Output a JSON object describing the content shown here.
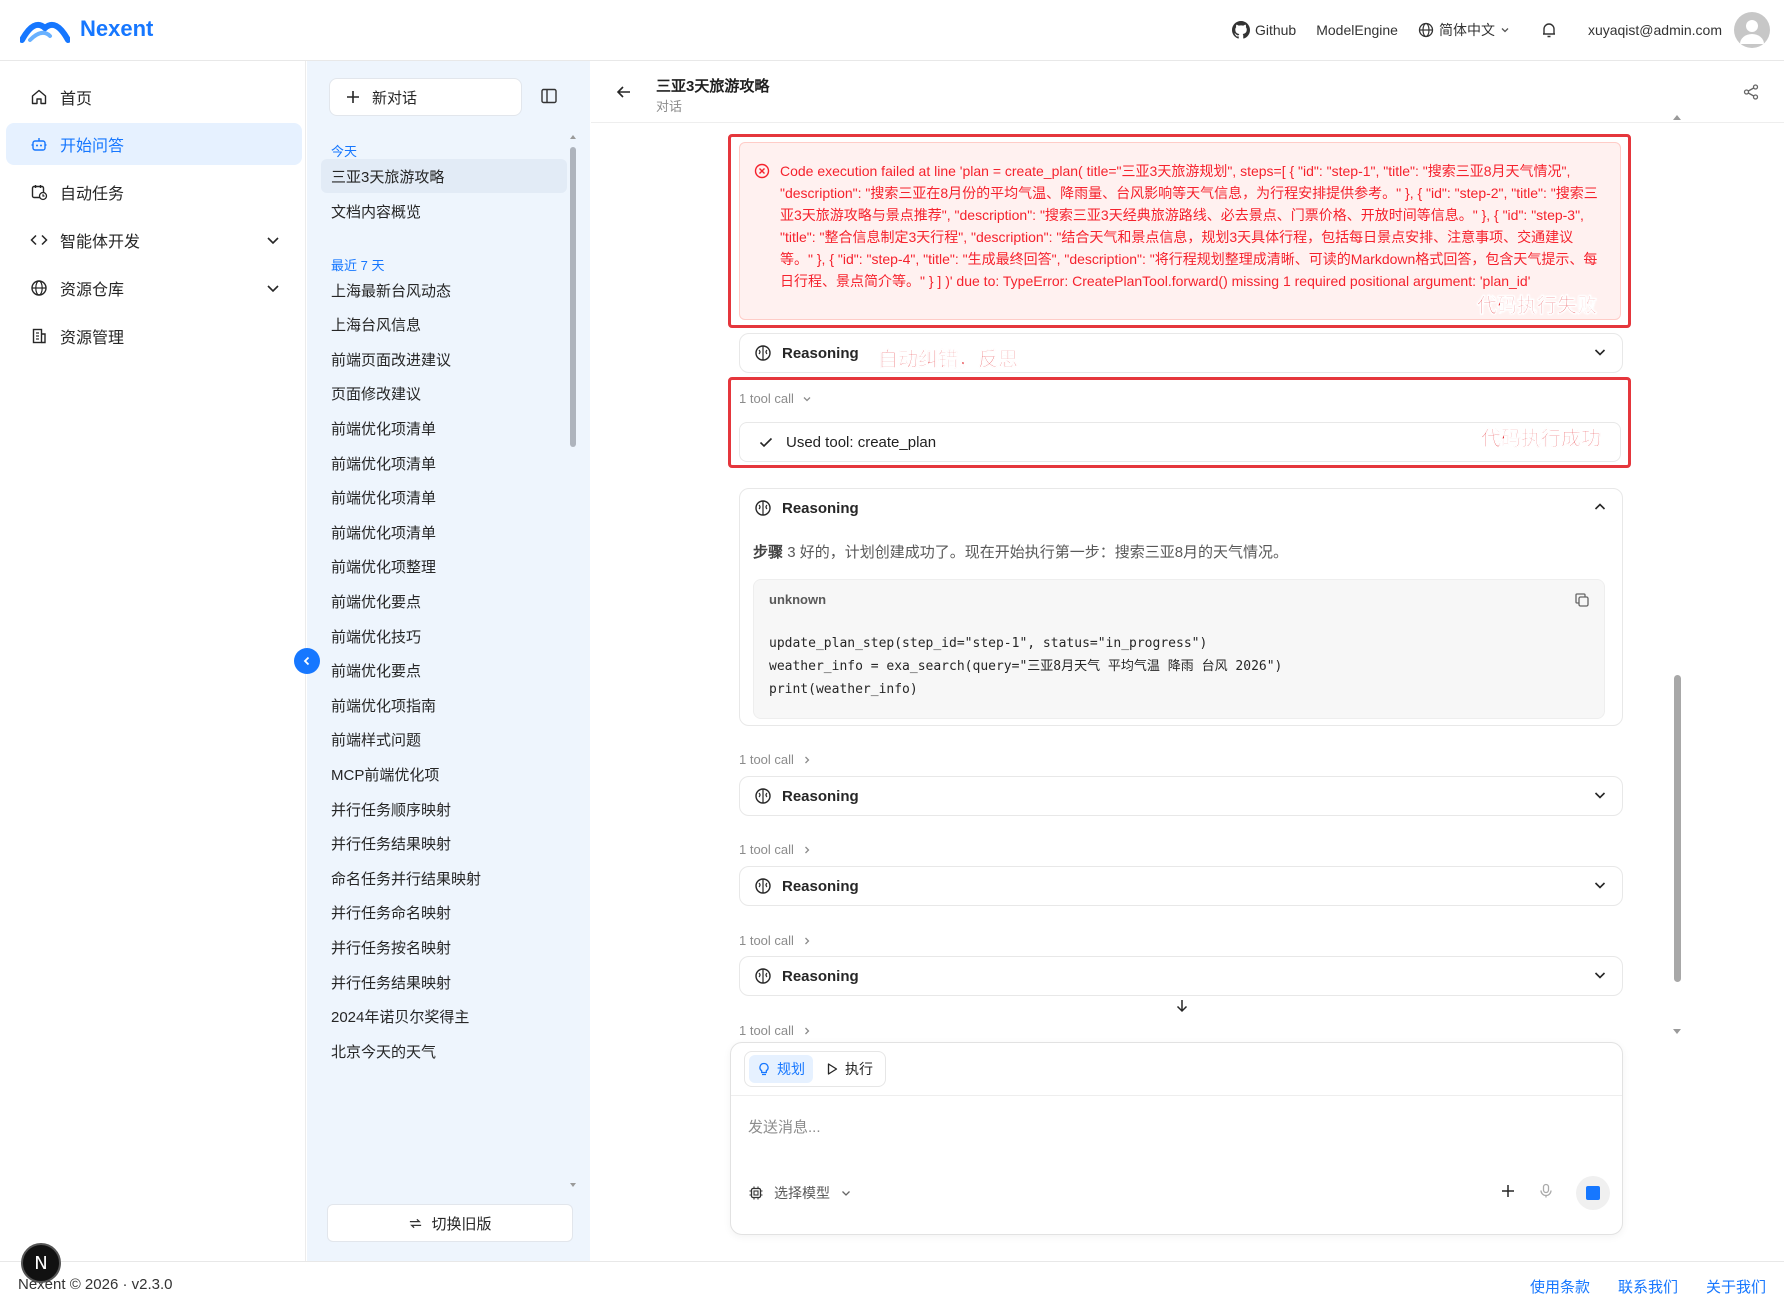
{
  "app": {
    "name": "Nexent",
    "brand_color": "#1677ff"
  },
  "topnav": {
    "github": "Github",
    "model_engine": "ModelEngine",
    "language": "简体中文",
    "user_email": "xuyaqist@admin.com"
  },
  "sidebar": {
    "items": [
      {
        "label": "首页",
        "icon": "home-icon"
      },
      {
        "label": "开始问答",
        "icon": "robot-icon",
        "active": true
      },
      {
        "label": "自动任务",
        "icon": "calendar-clock-icon"
      },
      {
        "label": "智能体开发",
        "icon": "code-icon",
        "expandable": true
      },
      {
        "label": "资源仓库",
        "icon": "globe-icon",
        "expandable": true
      },
      {
        "label": "资源管理",
        "icon": "building-icon"
      }
    ]
  },
  "conversations": {
    "new_chat": "新对话",
    "today_label": "今天",
    "today": [
      "三亚3天旅游攻略",
      "文档内容概览"
    ],
    "week_label": "最近 7 天",
    "week": [
      "上海最新台风动态",
      "上海台风信息",
      "前端页面改进建议",
      "页面修改建议",
      "前端优化项清单",
      "前端优化项清单",
      "前端优化项清单",
      "前端优化项清单",
      "前端优化项整理",
      "前端优化要点",
      "前端优化技巧",
      "前端优化要点",
      "前端优化项指南",
      "前端样式问题",
      "MCP前端优化项",
      "并行任务顺序映射",
      "并行任务结果映射",
      "命名任务并行结果映射",
      "并行任务命名映射",
      "并行任务按名映射",
      "并行任务结果映射",
      "2024年诺贝尔奖得主",
      "北京今天的天气"
    ],
    "switch_old": "切换旧版"
  },
  "chat": {
    "title": "三亚3天旅游攻略",
    "subtitle": "对话",
    "error_text": "Code execution failed at line 'plan = create_plan( title=\"三亚3天旅游规划\", steps=[ { \"id\": \"step-1\", \"title\": \"搜索三亚8月天气情况\", \"description\": \"搜索三亚在8月份的平均气温、降雨量、台风影响等天气信息，为行程安排提供参考。\" }, { \"id\": \"step-2\", \"title\": \"搜索三亚3天旅游攻略与景点推荐\", \"description\": \"搜索三亚3天经典旅游路线、必去景点、门票价格、开放时间等信息。\" }, { \"id\": \"step-3\", \"title\": \"整合信息制定3天行程\", \"description\": \"结合天气和景点信息，规划3天具体行程，包括每日景点安排、注意事项、交通建议等。\" }, { \"id\": \"step-4\", \"title\": \"生成最终回答\", \"description\": \"将行程规划整理成清晰、可读的Markdown格式回答，包含天气提示、每日行程、景点简介等。\" } ] )' due to: TypeError: CreatePlanTool.forward() missing 1 required positional argument: 'plan_id'",
    "annotation_fail": "代码执行失败",
    "annotation_reflect": "自动纠错，反思",
    "annotation_success": "代码执行成功",
    "reasoning": "Reasoning",
    "tool_call": "1 tool call",
    "used_tool": "Used tool: create_plan",
    "step_label": "步骤",
    "step_num": "3",
    "step_text": "好的，计划创建成功了。现在开始执行第一步：搜索三亚8月的天气情况。",
    "code_lang": "unknown",
    "code": "update_plan_step(step_id=\"step-1\", status=\"in_progress\")\nweather_info = exa_search(query=\"三亚8月天气 平均气温 降雨 台风 2026\")\nprint(weather_info)"
  },
  "input": {
    "mode_plan": "规划",
    "mode_exec": "执行",
    "placeholder": "发送消息...",
    "model_select": "选择模型"
  },
  "footer": {
    "copyright": "Nexent © 2026 · v2.3.0",
    "links": [
      "使用条款",
      "联系我们",
      "关于我们"
    ]
  },
  "colors": {
    "error_red": "#f5222d",
    "annotation_red": "#e5363c",
    "active_bg": "#e6f1ff"
  }
}
